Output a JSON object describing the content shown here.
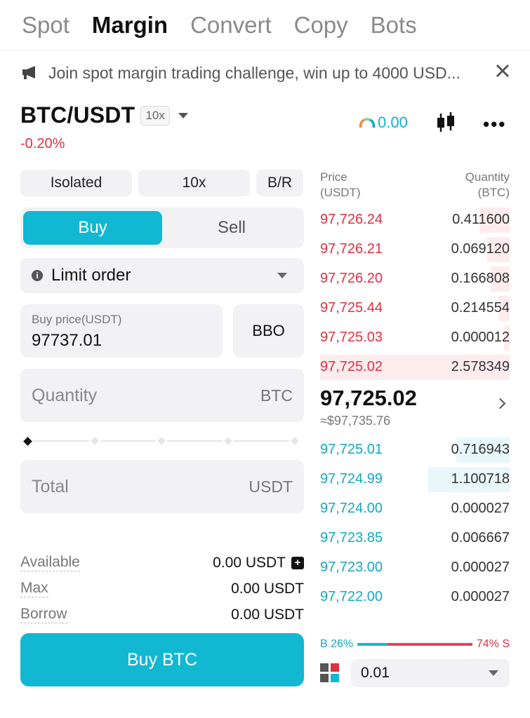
{
  "tabs": [
    {
      "label": "Spot"
    },
    {
      "label": "Margin"
    },
    {
      "label": "Convert"
    },
    {
      "label": "Copy"
    },
    {
      "label": "Bots"
    }
  ],
  "active_tab": "Margin",
  "banner": {
    "text": "Join spot margin trading challenge, win up to 4000 USD..."
  },
  "pair": {
    "name": "BTC/USDT",
    "leverage_badge": "10x",
    "change": "-0.20%"
  },
  "header_tools": {
    "gauge_value": "0.00"
  },
  "form": {
    "mode": "Isolated",
    "leverage": "10x",
    "br": "B/R",
    "buy_label": "Buy",
    "sell_label": "Sell",
    "order_type": "Limit order",
    "price_caption": "Buy price(USDT)",
    "price_value": "97737.01",
    "bbo_label": "BBO",
    "quantity_placeholder": "Quantity",
    "quantity_unit": "BTC",
    "total_placeholder": "Total",
    "total_unit": "USDT",
    "available_label": "Available",
    "available_value": "0.00 USDT",
    "max_label": "Max",
    "max_value": "0.00 USDT",
    "borrow_label": "Borrow",
    "borrow_value": "0.00 USDT",
    "submit_label": "Buy BTC",
    "slider_level": 0
  },
  "book": {
    "price_header": "Price\n(USDT)",
    "qty_header": "Quantity\n(BTC)",
    "asks": [
      {
        "price": "97,726.24",
        "qty": "0.411600",
        "depth": 0.16
      },
      {
        "price": "97,726.21",
        "qty": "0.069120",
        "depth": 0.12
      },
      {
        "price": "97,726.20",
        "qty": "0.166808",
        "depth": 0.1
      },
      {
        "price": "97,725.44",
        "qty": "0.214554",
        "depth": 0.06
      },
      {
        "price": "97,725.03",
        "qty": "0.000012",
        "depth": 0.03
      },
      {
        "price": "97,725.02",
        "qty": "2.578349",
        "depth": 1.0
      }
    ],
    "last_price": "97,725.02",
    "last_usd": "≈$97,735.76",
    "bids": [
      {
        "price": "97,725.01",
        "qty": "0.716943",
        "depth": 0.28
      },
      {
        "price": "97,724.99",
        "qty": "1.100718",
        "depth": 0.43
      },
      {
        "price": "97,724.00",
        "qty": "0.000027",
        "depth": 0.0
      },
      {
        "price": "97,723.85",
        "qty": "0.006667",
        "depth": 0.0
      },
      {
        "price": "97,723.00",
        "qty": "0.000027",
        "depth": 0.0
      },
      {
        "price": "97,722.00",
        "qty": "0.000027",
        "depth": 0.0
      }
    ],
    "buy_ratio_label": "B 26%",
    "sell_ratio_label": "74% S",
    "buy_ratio": 26,
    "precision": "0.01"
  },
  "colors": {
    "accent": "#12b8d2",
    "ask": "#e0303f",
    "bid": "#13a9bf"
  }
}
